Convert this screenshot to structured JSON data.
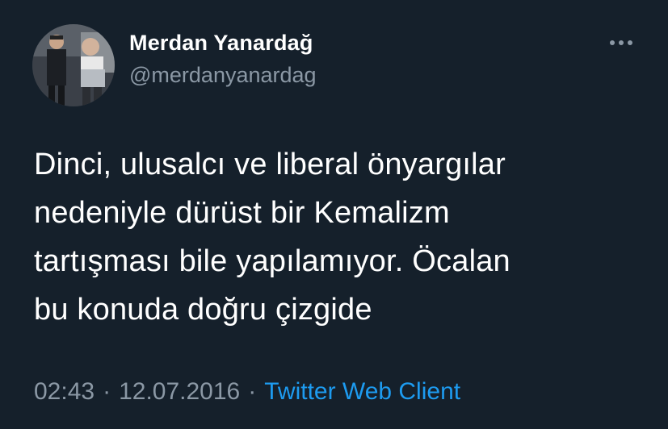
{
  "tweet": {
    "author": {
      "display_name": "Merdan Yanardağ",
      "handle": "@merdanyanardag",
      "avatar_icon": "profile-photo"
    },
    "more_icon": "more-horizontal-icon",
    "text_lines": [
      "Dinci, ulusalcı ve liberal önyargılar",
      "nedeniyle dürüst bir Kemalizm",
      "tartışması bile yapılamıyor. Öcalan",
      "bu konuda doğru çizgide"
    ],
    "time": "02:43",
    "separator": "·",
    "date": "12.07.2016",
    "source": "Twitter Web Client"
  },
  "colors": {
    "background": "#15202b",
    "primary_text": "#ffffff",
    "secondary_text": "#8b98a5",
    "link": "#1d9bf0"
  }
}
